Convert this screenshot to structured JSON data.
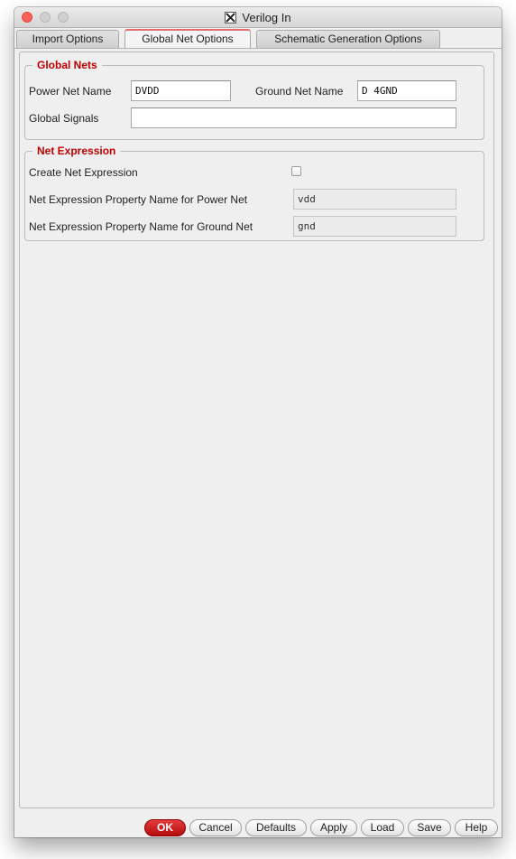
{
  "window": {
    "title": "Verilog In"
  },
  "tabs": [
    {
      "label": "Import Options",
      "active": false
    },
    {
      "label": "Global Net Options",
      "active": true
    },
    {
      "label": "Schematic Generation Options",
      "active": false
    }
  ],
  "global_nets": {
    "title": "Global Nets",
    "power_label": "Power Net Name",
    "power_value": "DVDD",
    "ground_label": "Ground Net Name",
    "ground_value": "D 4GND",
    "signals_label": "Global Signals",
    "signals_value": ""
  },
  "net_expression": {
    "title": "Net Expression",
    "create_label": "Create Net Expression",
    "create_checked": false,
    "power_prop_label": "Net Expression Property Name for Power Net",
    "power_prop_value": "vdd",
    "ground_prop_label": "Net Expression Property Name for Ground Net",
    "ground_prop_value": "gnd"
  },
  "buttons": {
    "ok": "OK",
    "cancel": "Cancel",
    "defaults": "Defaults",
    "apply": "Apply",
    "load": "Load",
    "save": "Save",
    "help": "Help"
  },
  "colors": {
    "group_title": "#c00000",
    "primary_button": "#c41515",
    "close_button": "#fc5f57"
  }
}
